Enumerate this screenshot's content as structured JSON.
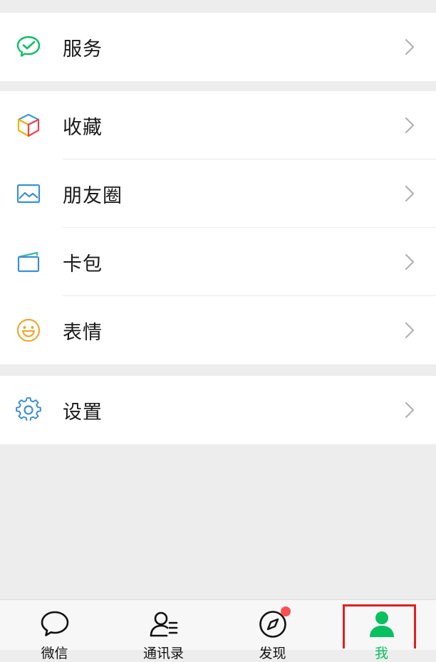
{
  "menu": {
    "service": {
      "label": "服务",
      "icon": "wechat-pay-icon"
    },
    "favorites": {
      "label": "收藏",
      "icon": "cube-icon"
    },
    "moments": {
      "label": "朋友圈",
      "icon": "picture-icon"
    },
    "cards": {
      "label": "卡包",
      "icon": "card-wallet-icon"
    },
    "stickers": {
      "label": "表情",
      "icon": "smiley-icon"
    },
    "settings": {
      "label": "设置",
      "icon": "gear-icon"
    }
  },
  "tabbar": {
    "tabs": [
      {
        "label": "微信",
        "icon": "chat-bubble-icon",
        "active": false
      },
      {
        "label": "通讯录",
        "icon": "contacts-icon",
        "active": false
      },
      {
        "label": "发现",
        "icon": "compass-icon",
        "active": false,
        "badge": true
      },
      {
        "label": "我",
        "icon": "person-icon",
        "active": true
      }
    ]
  },
  "colors": {
    "accent": "#07c160",
    "badge": "#fa5151",
    "highlight": "#e02020",
    "background": "#ededed"
  }
}
